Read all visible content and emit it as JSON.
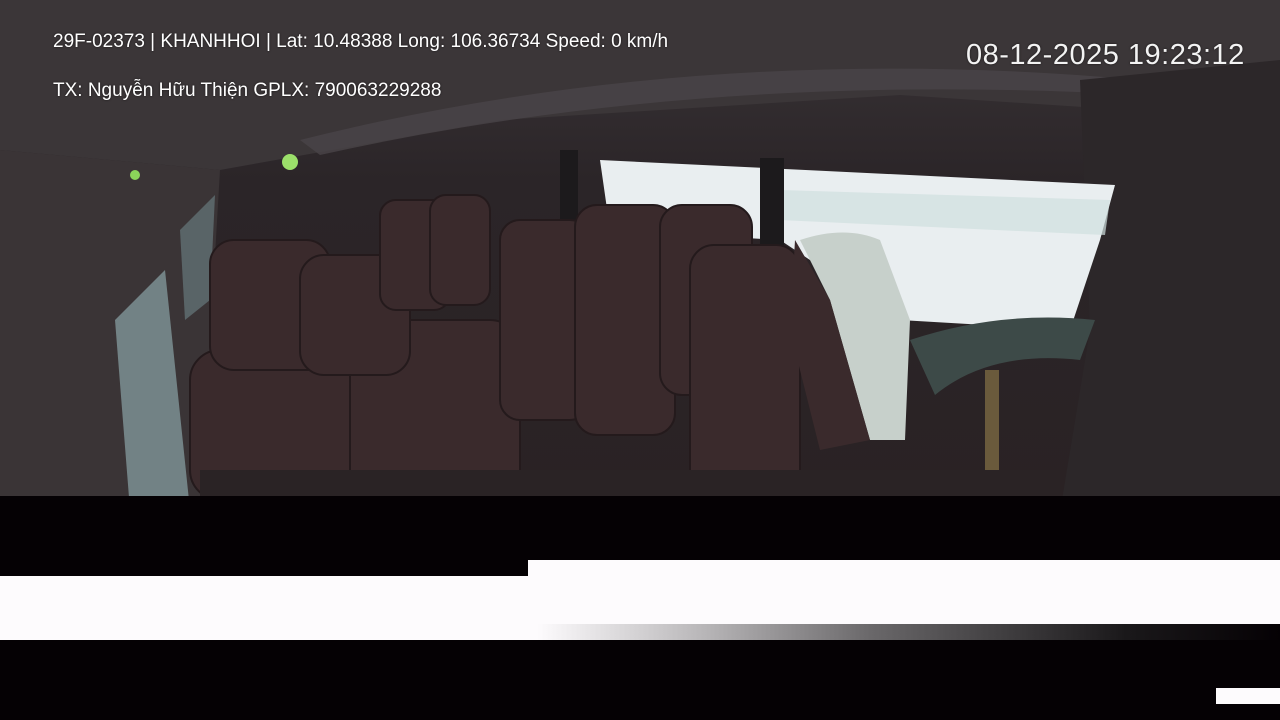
{
  "overlay": {
    "vehicle_info": "29F-02373 | KHANHHOI | Lat: 10.48388 Long: 106.36734 Speed: 0 km/h",
    "driver_info": "TX: Nguyễn Hữu Thiện GPLX: 790063229288",
    "timestamp": "08-12-2025 19:23:12"
  }
}
